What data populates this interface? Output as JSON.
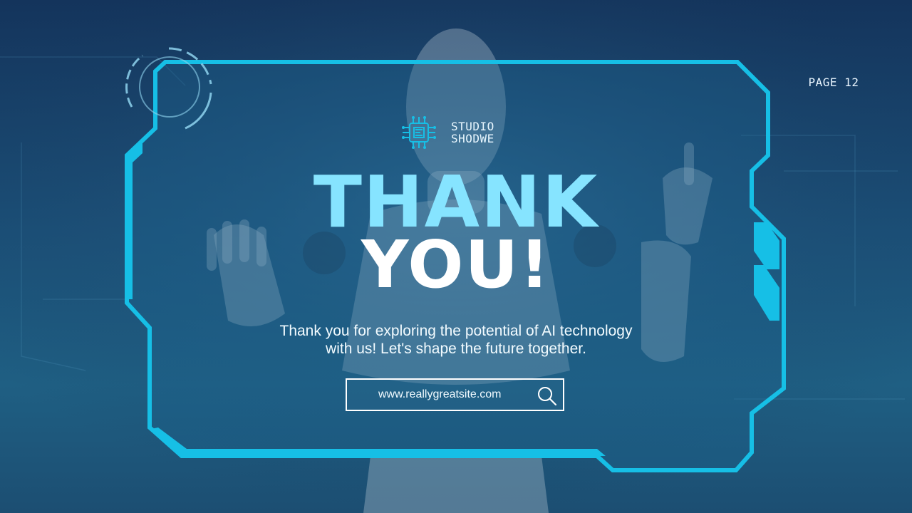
{
  "page": {
    "label": "PAGE 12"
  },
  "brand": {
    "line1": "STUDIO",
    "line2": "SHODWE",
    "icon": "chip-icon"
  },
  "headline": {
    "line1": "THANK",
    "line2": "YOU!"
  },
  "body": {
    "line1": "Thank you for exploring the potential of AI technology",
    "line2": "with us! Let's shape the future together."
  },
  "search": {
    "text": "www.reallygreatsite.com",
    "icon": "search-icon"
  },
  "colors": {
    "accent": "#16bfe6",
    "headline_accent": "#86e4ff",
    "text": "#ffffff",
    "background": "#1b4f77"
  }
}
